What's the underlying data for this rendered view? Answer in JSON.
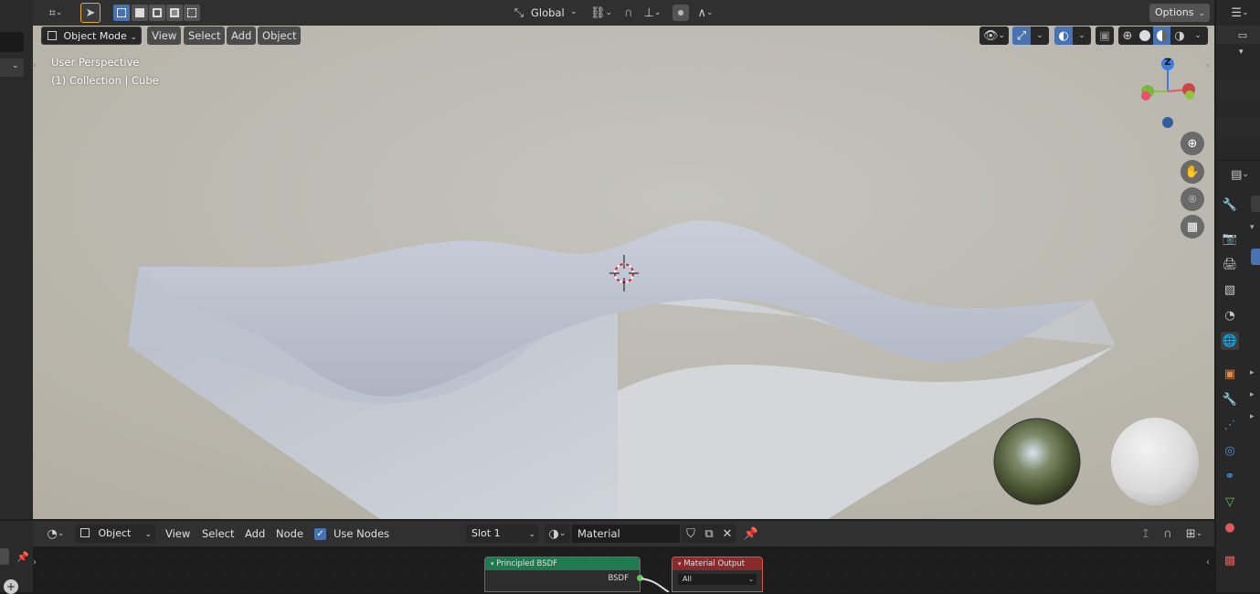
{
  "top_header": {
    "orientation_label": "Global",
    "options_label": "Options"
  },
  "viewport_header": {
    "mode_label": "Object Mode",
    "menus": [
      "View",
      "Select",
      "Add",
      "Object"
    ]
  },
  "viewport": {
    "overlay_line1": "User Perspective",
    "overlay_line2": "(1) Collection | Cube",
    "gizmo_axis_label": "Z"
  },
  "node_editor_header": {
    "object_type_label": "Object",
    "menus": [
      "View",
      "Select",
      "Add",
      "Node"
    ],
    "use_nodes_label": "Use Nodes",
    "use_nodes_checked": true,
    "slot_label": "Slot 1",
    "material_name": "Material"
  },
  "nodes": {
    "principled_title": "Principled BSDF",
    "principled_output": "BSDF",
    "output_title": "Material Output",
    "output_target": "All"
  },
  "colors": {
    "accent": "#4772b3",
    "principled_header": "#1f7a4f",
    "output_header": "#8b2a2a"
  }
}
